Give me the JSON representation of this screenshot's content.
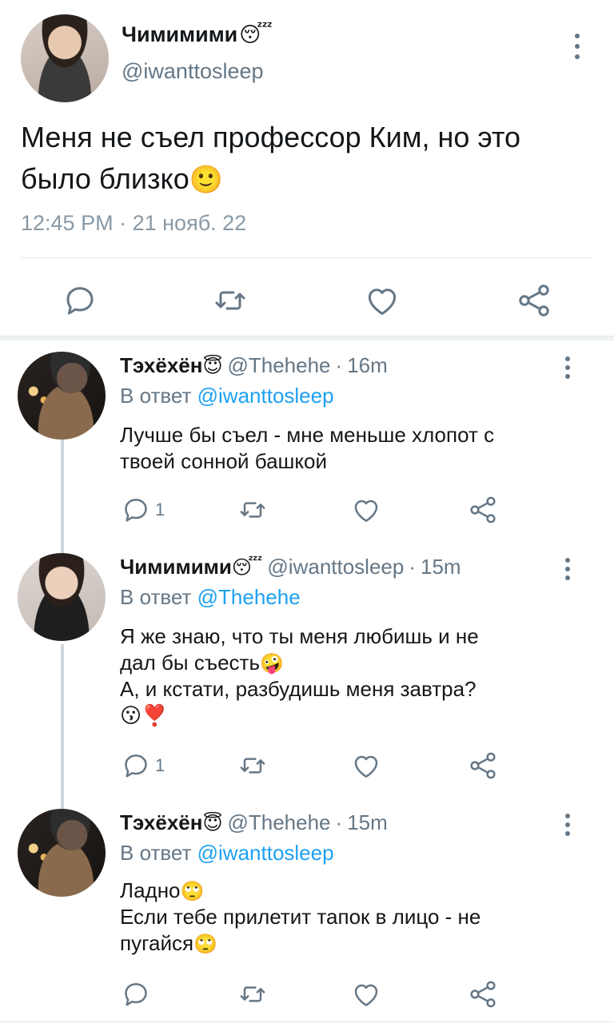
{
  "main_tweet": {
    "author_name": "Чимимими",
    "author_emoji": "😴",
    "handle": "@iwanttosleep",
    "text_line1": "Меня не съел профессор Ким, но это",
    "text_line2": "было близко",
    "text_emoji": "🙂",
    "time": "12:45 PM",
    "separator": "·",
    "date": "21 нояб. 22"
  },
  "replies": [
    {
      "name": "Тэхёхён",
      "emoji": "😇",
      "handle": "@Thehehe",
      "separator": "·",
      "time": "16m",
      "reply_prefix": "В ответ",
      "reply_to": "@iwanttosleep",
      "line1": "Лучше бы съел - мне меньше хлопот с",
      "line2": "твоей сонной башкой",
      "reply_count": "1"
    },
    {
      "name": "Чимимими",
      "emoji": "😴",
      "handle": "@iwanttosleep",
      "separator": "·",
      "time": "15m",
      "reply_prefix": "В ответ",
      "reply_to": "@Thehehe",
      "line1": "Я же знаю, что ты меня любишь и не",
      "line2": "дал бы съесть",
      "line2_emoji": "🤪",
      "line3": "А, и кстати, разбудишь меня завтра?",
      "line4_emoji": "😗❣️",
      "reply_count": "1"
    },
    {
      "name": "Тэхёхён",
      "emoji": "😇",
      "handle": "@Thehehe",
      "separator": "·",
      "time": "15m",
      "reply_prefix": "В ответ",
      "reply_to": "@iwanttosleep",
      "line1": "Ладно",
      "line1_emoji": "🙄",
      "line2": "Если тебе прилетит тапок в лицо - не",
      "line3": "пугайся",
      "line3_emoji": "🙄"
    }
  ],
  "icons": {
    "reply": "reply-icon",
    "retweet": "retweet-icon",
    "like": "heart-icon",
    "share": "share-icon",
    "more": "more-vertical-icon"
  },
  "colors": {
    "text": "#14171a",
    "secondary": "#657786",
    "link": "#1da1f2",
    "icon": "#657786"
  }
}
